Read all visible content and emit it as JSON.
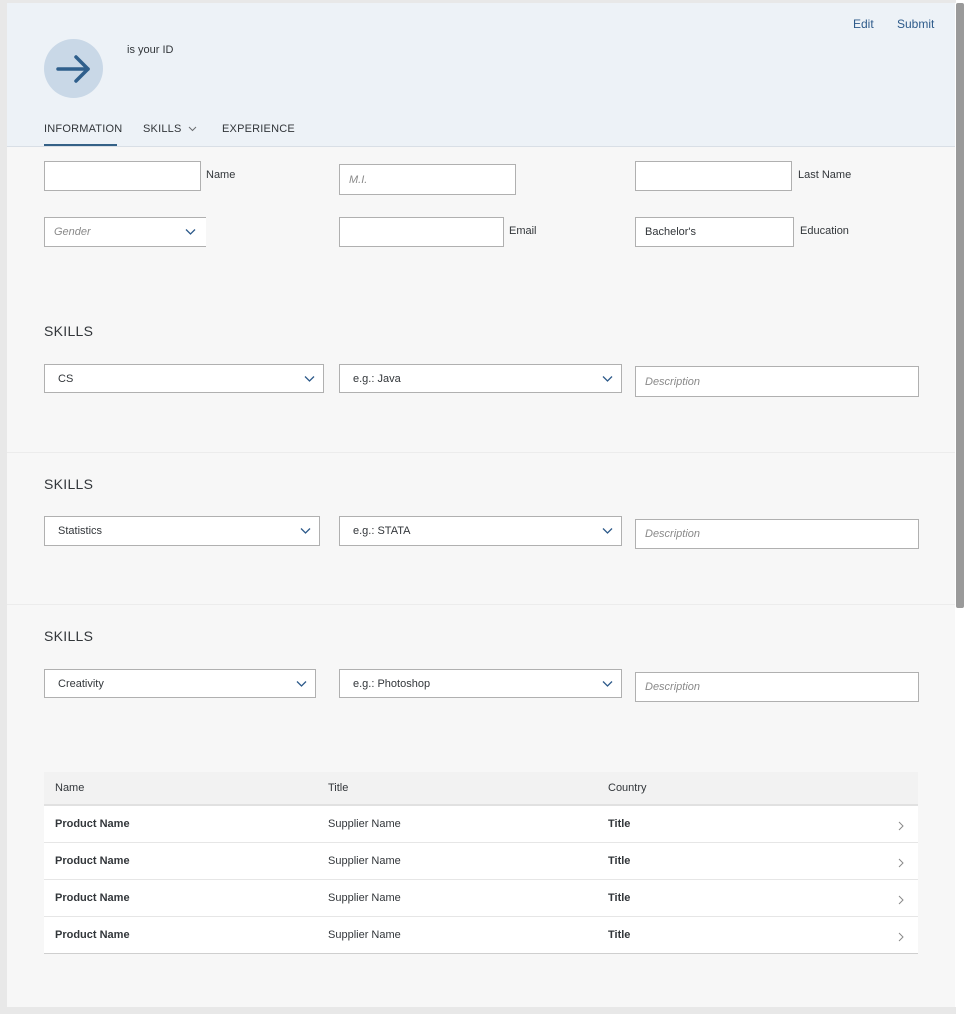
{
  "header": {
    "id_text": "is your ID",
    "edit_label": "Edit",
    "submit_label": "Submit",
    "avatar_icon": "arrow-right-icon"
  },
  "tabs": [
    {
      "label": "INFORMATION",
      "selected": true
    },
    {
      "label": "SKILLS",
      "has_dropdown": true
    },
    {
      "label": "EXPERIENCE"
    }
  ],
  "form": {
    "name_label": "Name",
    "mi_placeholder": "M.I.",
    "last_name_label": "Last Name",
    "gender_placeholder": "Gender",
    "email_label": "Email",
    "education_value": "Bachelor's",
    "education_label": "Education"
  },
  "skill_sections": [
    {
      "title": "SKILLS",
      "category": "CS",
      "example": "e.g.: Java",
      "description_placeholder": "Description"
    },
    {
      "title": "SKILLS",
      "category": "Statistics",
      "example": "e.g.: STATA",
      "description_placeholder": "Description"
    },
    {
      "title": "SKILLS",
      "category": "Creativity",
      "example": "e.g.: Photoshop",
      "description_placeholder": "Description"
    }
  ],
  "table": {
    "columns": [
      "Name",
      "Title",
      "Country"
    ],
    "rows": [
      [
        "Product Name",
        "Supplier Name",
        "Title"
      ],
      [
        "Product Name",
        "Supplier Name",
        "Title"
      ],
      [
        "Product Name",
        "Supplier Name",
        "Title"
      ],
      [
        "Product Name",
        "Supplier Name",
        "Title"
      ]
    ]
  },
  "colors": {
    "header_bg": "#edf2f7",
    "accent": "#346187",
    "link": "#2d5a8a"
  }
}
